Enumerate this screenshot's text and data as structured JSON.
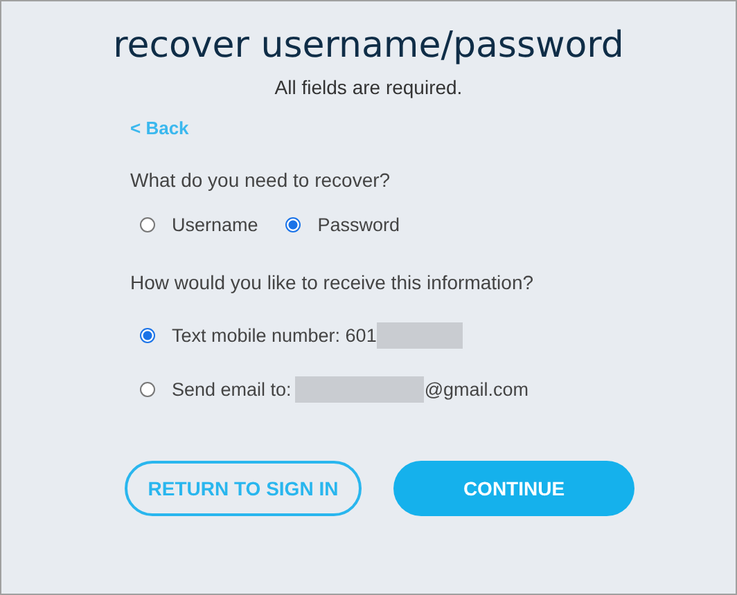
{
  "title": "recover username/password",
  "subtitle": "All fields are required.",
  "back_link": "< Back",
  "recover_question": "What do you need to recover?",
  "recover_options": [
    {
      "label": "Username",
      "selected": false
    },
    {
      "label": "Password",
      "selected": true
    }
  ],
  "receive_question": "How would you like to receive this information?",
  "receive_options": [
    {
      "label": "Text mobile number: 601",
      "redacted": true,
      "selected": true
    },
    {
      "label": "Send email to:",
      "redacted": true,
      "suffix": "@gmail.com",
      "selected": false
    }
  ],
  "buttons": [
    {
      "label": "RETURN TO SIGN IN",
      "kind": "secondary"
    },
    {
      "label": "CONTINUE",
      "kind": "primary"
    }
  ]
}
